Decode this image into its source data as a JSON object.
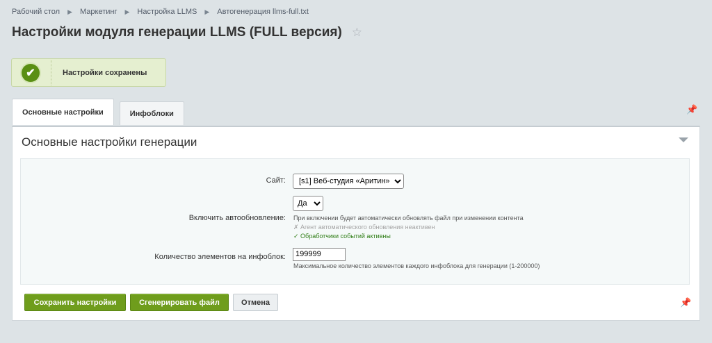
{
  "breadcrumb": {
    "items": [
      "Рабочий стол",
      "Маркетинг",
      "Настройка LLMS",
      "Автогенерация llms-full.txt"
    ]
  },
  "page": {
    "title": "Настройки модуля генерации LLMS (FULL версия)",
    "star_icon": "☆"
  },
  "notice": {
    "text": "Настройки сохранены",
    "icon": "✔"
  },
  "tabs": [
    {
      "label": "Основные настройки",
      "active": true
    },
    {
      "label": "Инфоблоки",
      "active": false
    }
  ],
  "section": {
    "title": "Основные настройки генерации"
  },
  "form": {
    "site": {
      "label": "Сайт:",
      "value": "[s1] Веб-студия «Аритин»"
    },
    "autoupdate": {
      "label": "Включить автообновление:",
      "value": "Да",
      "hint": "При включении будет автоматически обновлять файл при изменении контента",
      "status_inactive": "✗ Агент автоматического обновления неактивен",
      "status_active": "✓ Обработчики событий активны"
    },
    "count": {
      "label": "Количество элементов на инфоблок:",
      "value": "199999",
      "hint": "Максимальное количество элементов каждого инфоблока для генерации (1-200000)"
    }
  },
  "buttons": {
    "save": "Сохранить настройки",
    "generate": "Сгенерировать файл",
    "cancel": "Отмена"
  },
  "colors": {
    "accent_green": "#6f9d1c",
    "notice_bg": "#e5efd0",
    "page_bg": "#dde3e6"
  }
}
